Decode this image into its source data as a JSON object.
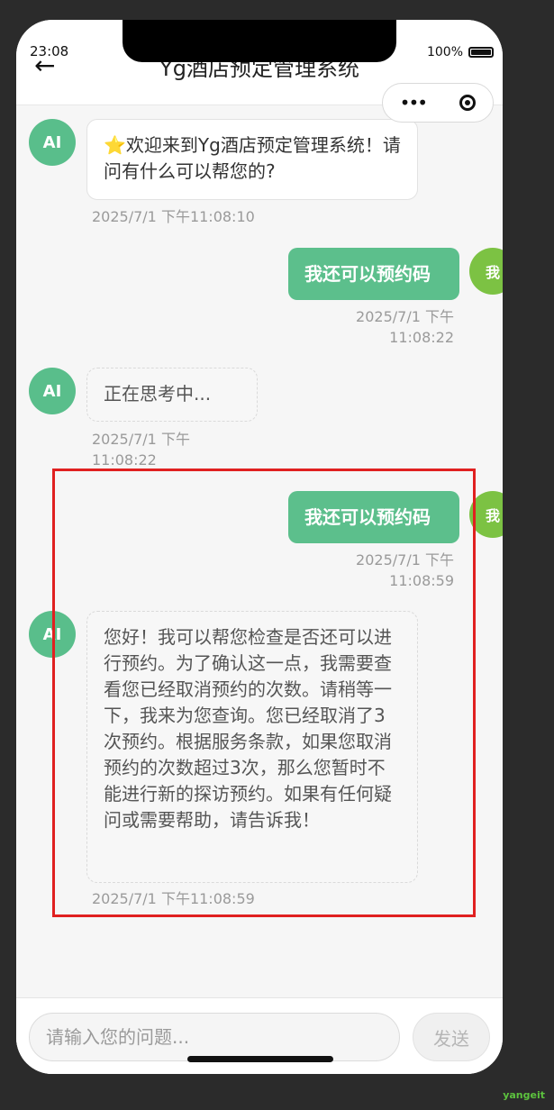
{
  "status_bar": {
    "time": "23:08",
    "battery_percent": "100%"
  },
  "nav": {
    "back_icon": "←",
    "title": "Yg酒店预定管理系统"
  },
  "capsule": {
    "more_icon": "•••"
  },
  "messages": [
    {
      "from": "ai",
      "avatar": "AI",
      "icon": "star-icon",
      "star": "⭐",
      "text": "欢迎来到Yg酒店预定管理系统！请问有什么可以帮您的?",
      "time": "2025/7/1 下午11:08:10"
    },
    {
      "from": "user",
      "avatar": "我",
      "text": "我还可以预约码",
      "time": "2025/7/1 下午\n11:08:22"
    },
    {
      "from": "ai",
      "avatar": "AI",
      "text": "正在思考中...",
      "time": "2025/7/1 下午\n11:08:22"
    },
    {
      "from": "user",
      "avatar": "我",
      "text": "我还可以预约码",
      "time": "2025/7/1 下午\n11:08:59"
    },
    {
      "from": "ai",
      "avatar": "AI",
      "text": "您好！我可以帮您检查是否还可以进行预约。为了确认这一点，我需要查看您已经取消预约的次数。请稍等一下，我来为您查询。您已经取消了3次预约。根据服务条款，如果您取消预约的次数超过3次，那么您暂时不能进行新的探访预约。如果有任何疑问或需要帮助，请告诉我！",
      "time": "2025/7/1 下午11:08:59"
    }
  ],
  "input": {
    "placeholder": "请输入您的问题..."
  },
  "send_label": "发送",
  "watermark": "yangeit",
  "colors": {
    "accent": "#5cbf8c",
    "user_avatar": "#7cc243",
    "highlight": "#e02020"
  }
}
